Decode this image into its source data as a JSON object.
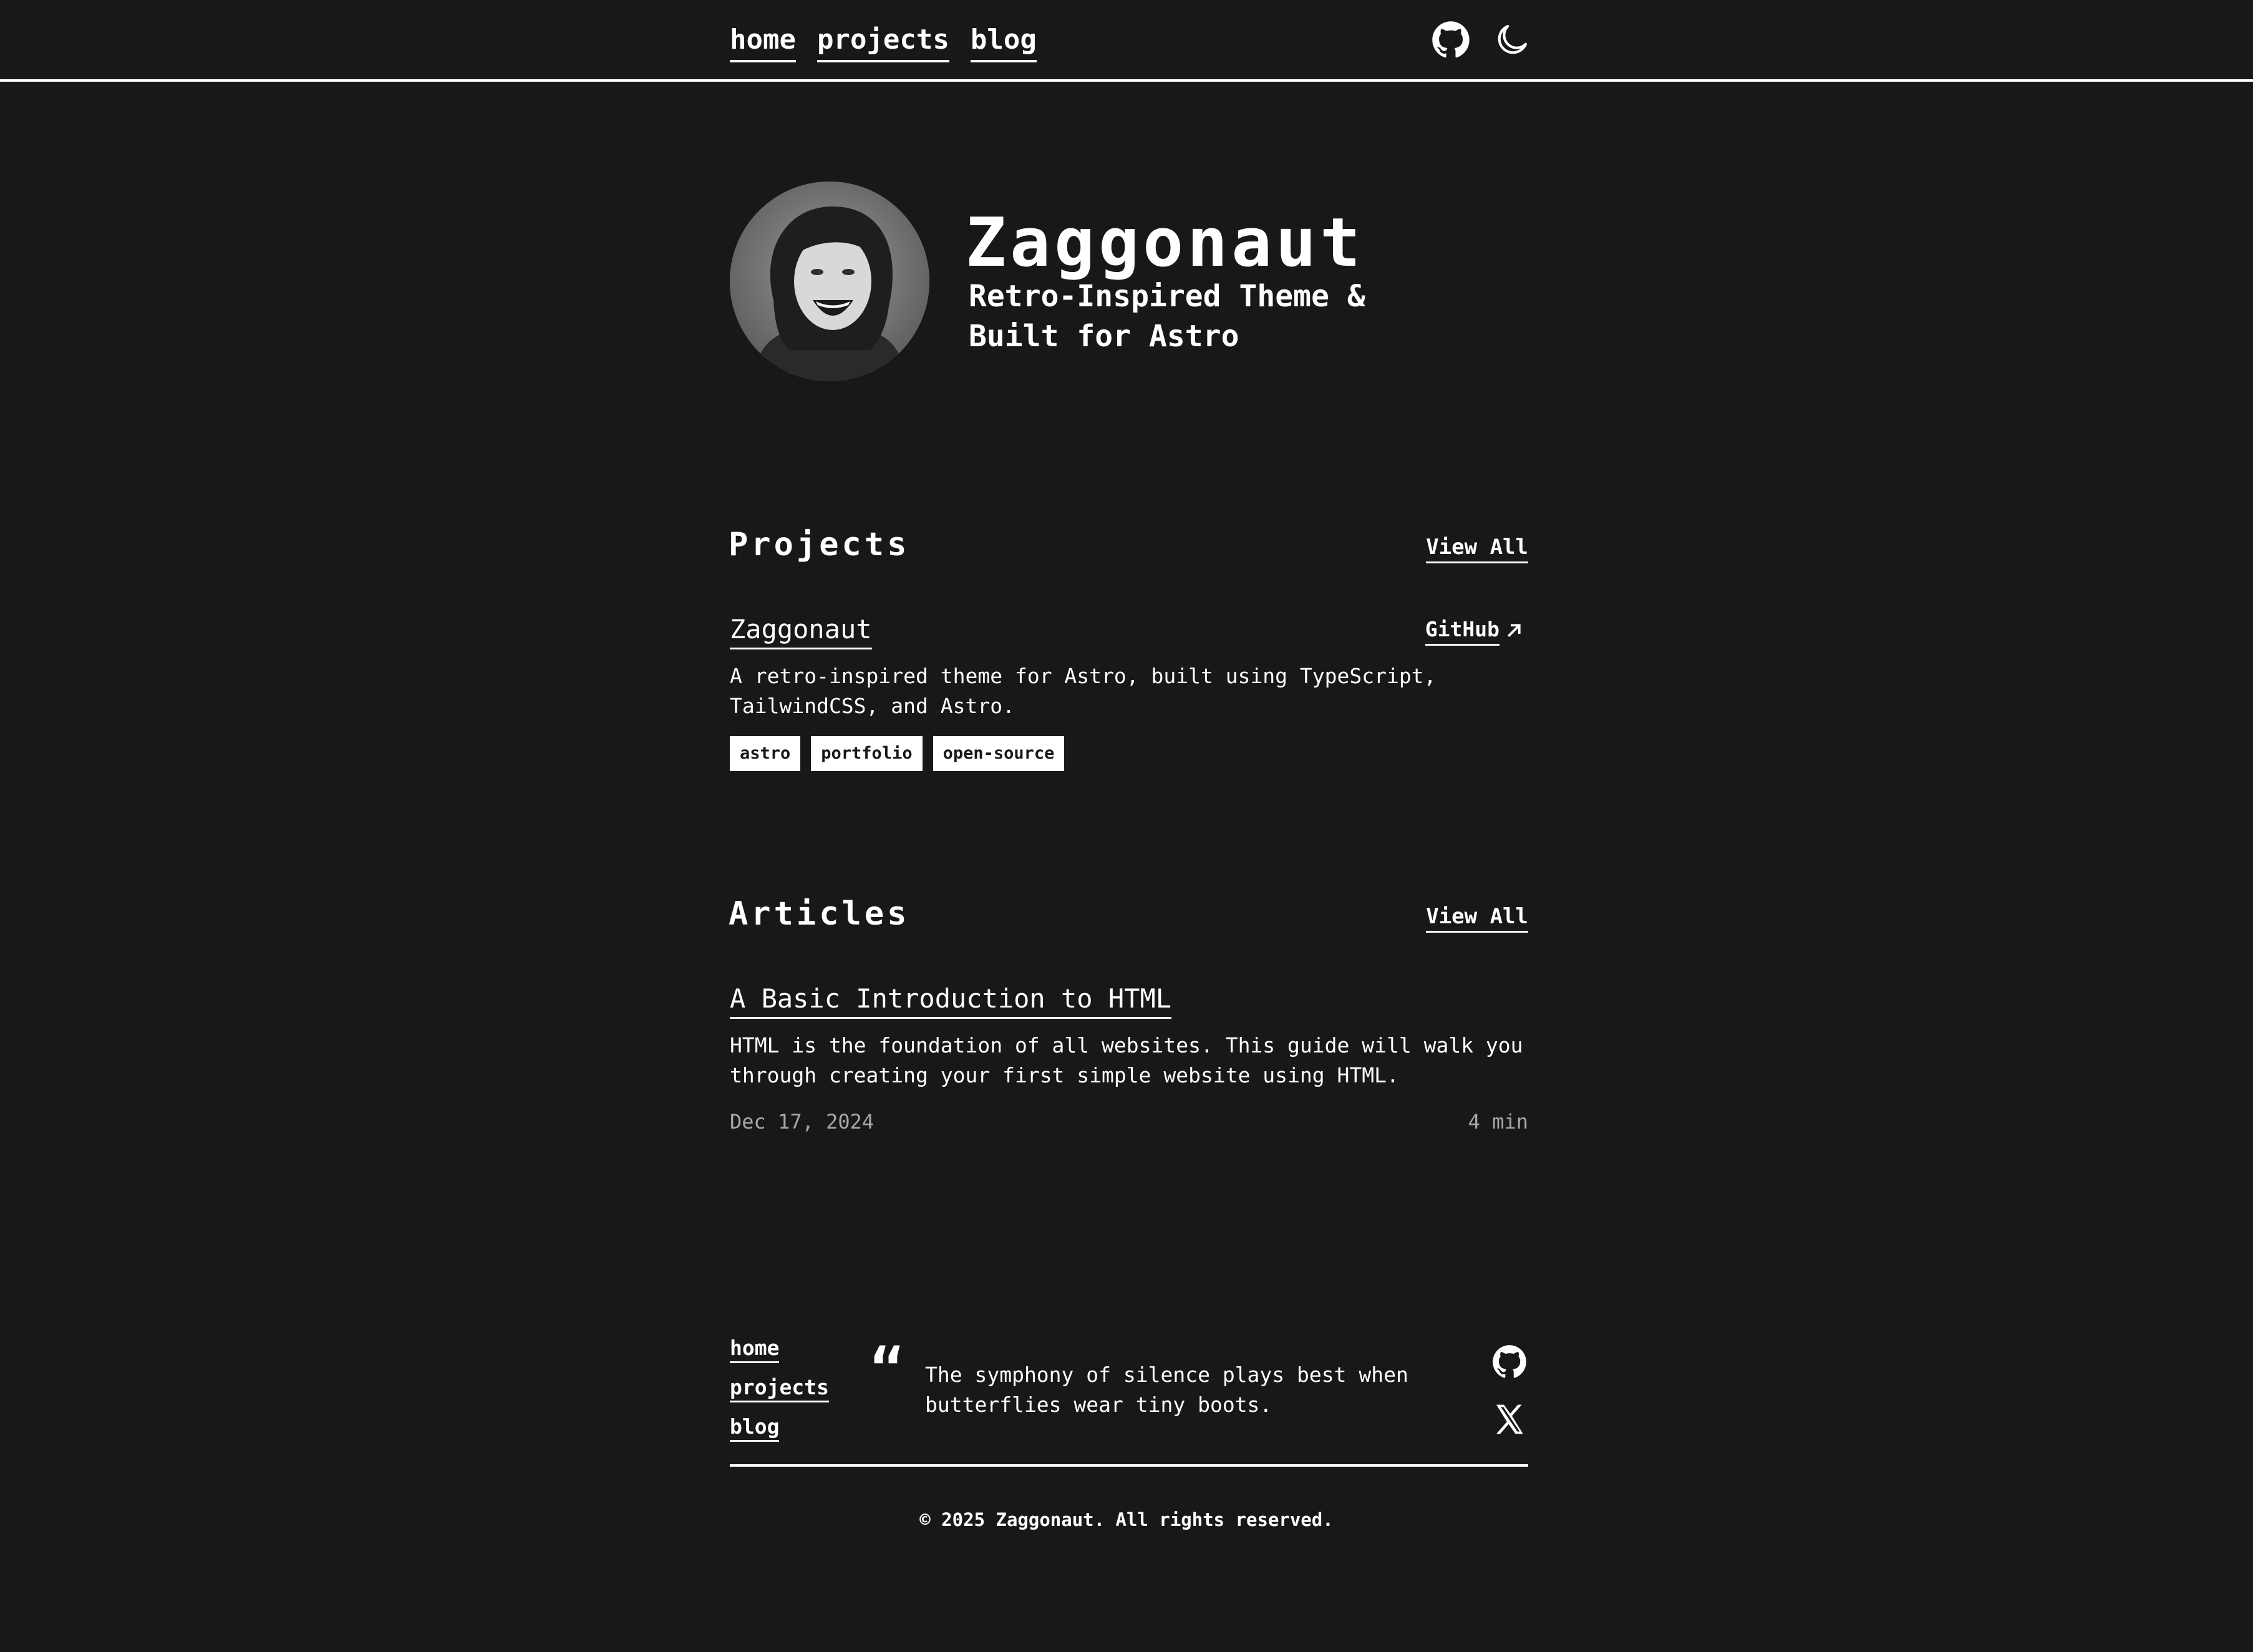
{
  "nav": {
    "items": [
      "home",
      "projects",
      "blog"
    ]
  },
  "header_icons": [
    "github-icon",
    "moon-icon"
  ],
  "hero": {
    "title": "Zaggonaut",
    "subtitle_line1": "Retro-Inspired Theme &",
    "subtitle_line2": "Built for Astro"
  },
  "projects": {
    "heading": "Projects",
    "view_all": "View All",
    "items": [
      {
        "title": "Zaggonaut",
        "link_label": "GitHub",
        "description": "A retro-inspired theme for Astro, built using TypeScript, TailwindCSS, and Astro.",
        "tags": [
          "astro",
          "portfolio",
          "open-source"
        ]
      }
    ]
  },
  "articles": {
    "heading": "Articles",
    "view_all": "View All",
    "items": [
      {
        "title": "A Basic Introduction to HTML",
        "description": "HTML is the foundation of all websites. This guide will walk you through creating your first simple website using HTML.",
        "date": "Dec 17, 2024",
        "read_time": "4 min"
      }
    ]
  },
  "footer": {
    "nav": [
      "home",
      "projects",
      "blog"
    ],
    "quote_mark": "“",
    "quote": "The symphony of silence plays best when butterflies wear tiny boots.",
    "social_icons": [
      "github-icon",
      "x-icon"
    ],
    "copyright": "© 2025 Zaggonaut. All rights reserved."
  },
  "colors": {
    "background": "#181818",
    "text": "#ffffff",
    "muted": "#a8a8a8"
  }
}
